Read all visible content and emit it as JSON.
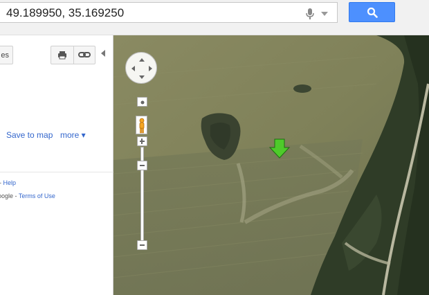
{
  "search": {
    "query": "49.189950, 35.169250",
    "mic_icon": "mic-icon",
    "dropdown_icon": "caret-down-icon",
    "button_icon": "search-icon",
    "button_color": "#4d90fe"
  },
  "panel": {
    "truncated_button_label": "es",
    "print_icon": "print-icon",
    "link_icon": "link-icon",
    "collapse_icon": "collapse-arrow-icon",
    "save_to_map": "Save to map",
    "more": "more ▾",
    "footer": {
      "line1_prefix": "-",
      "help": "Help",
      "line2_prefix": "oogle -",
      "terms": "Terms of Use"
    }
  },
  "map": {
    "type": "satellite",
    "marker": "green-arrow-marker",
    "controls": [
      "pan-control",
      "zoom-in",
      "pegman",
      "zoom-out"
    ]
  }
}
